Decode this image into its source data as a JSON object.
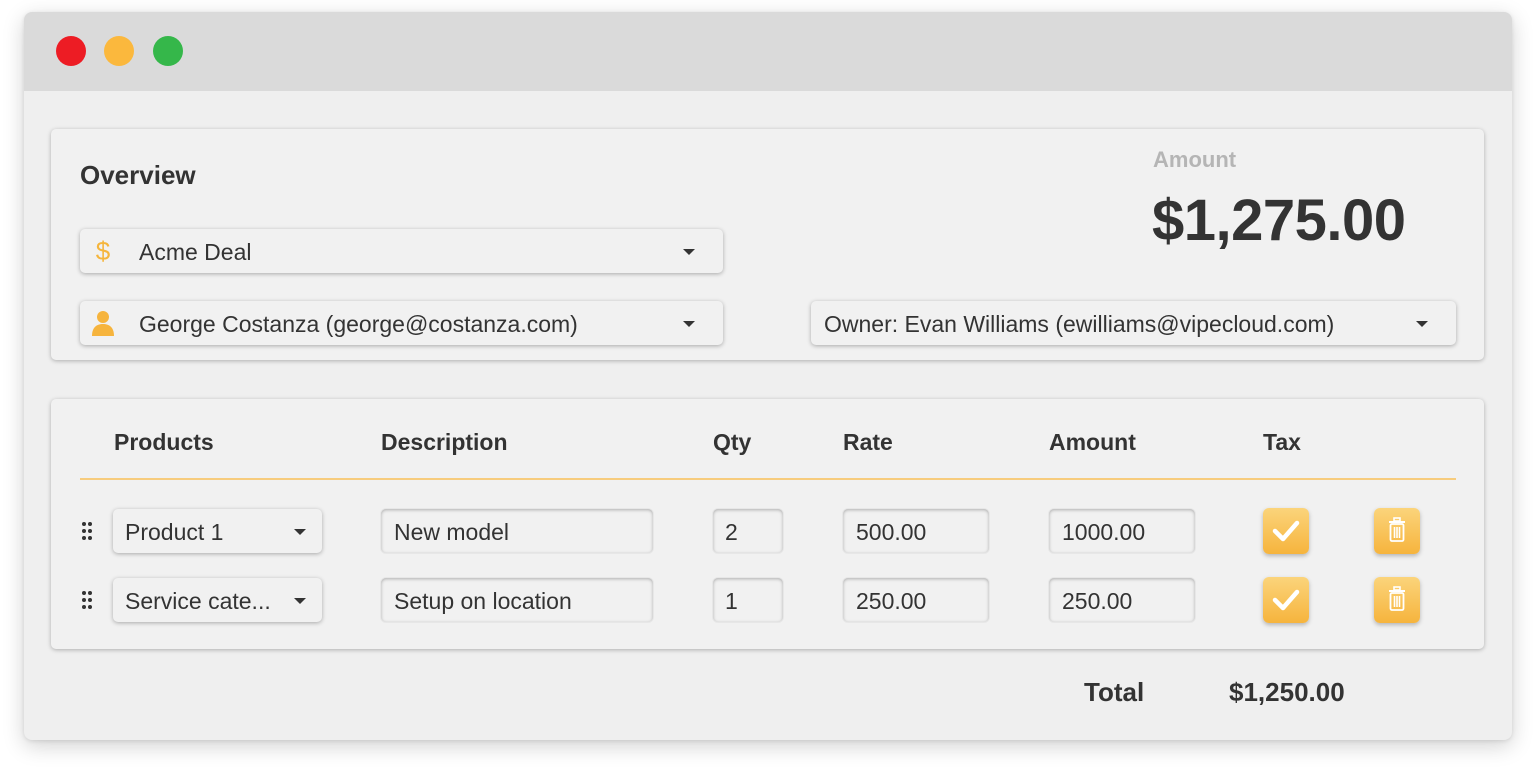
{
  "window": {
    "controls": [
      "close",
      "minimize",
      "maximize"
    ]
  },
  "overview": {
    "title": "Overview",
    "amount_label": "Amount",
    "amount_value": "$1,275.00",
    "deal": {
      "icon": "dollar-icon",
      "value": "Acme Deal"
    },
    "contact": {
      "icon": "person-icon",
      "value": "George Costanza (george@costanza.com)"
    },
    "owner": {
      "value": "Owner: Evan Williams (ewilliams@vipecloud.com)"
    }
  },
  "products": {
    "headers": {
      "products": "Products",
      "description": "Description",
      "qty": "Qty",
      "rate": "Rate",
      "amount": "Amount",
      "tax": "Tax"
    },
    "rows": [
      {
        "product": "Product 1",
        "description": "New model",
        "qty": "2",
        "rate": "500.00",
        "amount": "1000.00",
        "tax": true
      },
      {
        "product": "Service cate...",
        "description": "Setup on location",
        "qty": "1",
        "rate": "250.00",
        "amount": "250.00",
        "tax": true
      }
    ]
  },
  "total": {
    "label": "Total",
    "value": "$1,250.00"
  },
  "colors": {
    "accent": "#f6b43d",
    "close": "#ed1c24",
    "minimize": "#fbb83d",
    "maximize": "#35b74a",
    "text": "#333333"
  }
}
